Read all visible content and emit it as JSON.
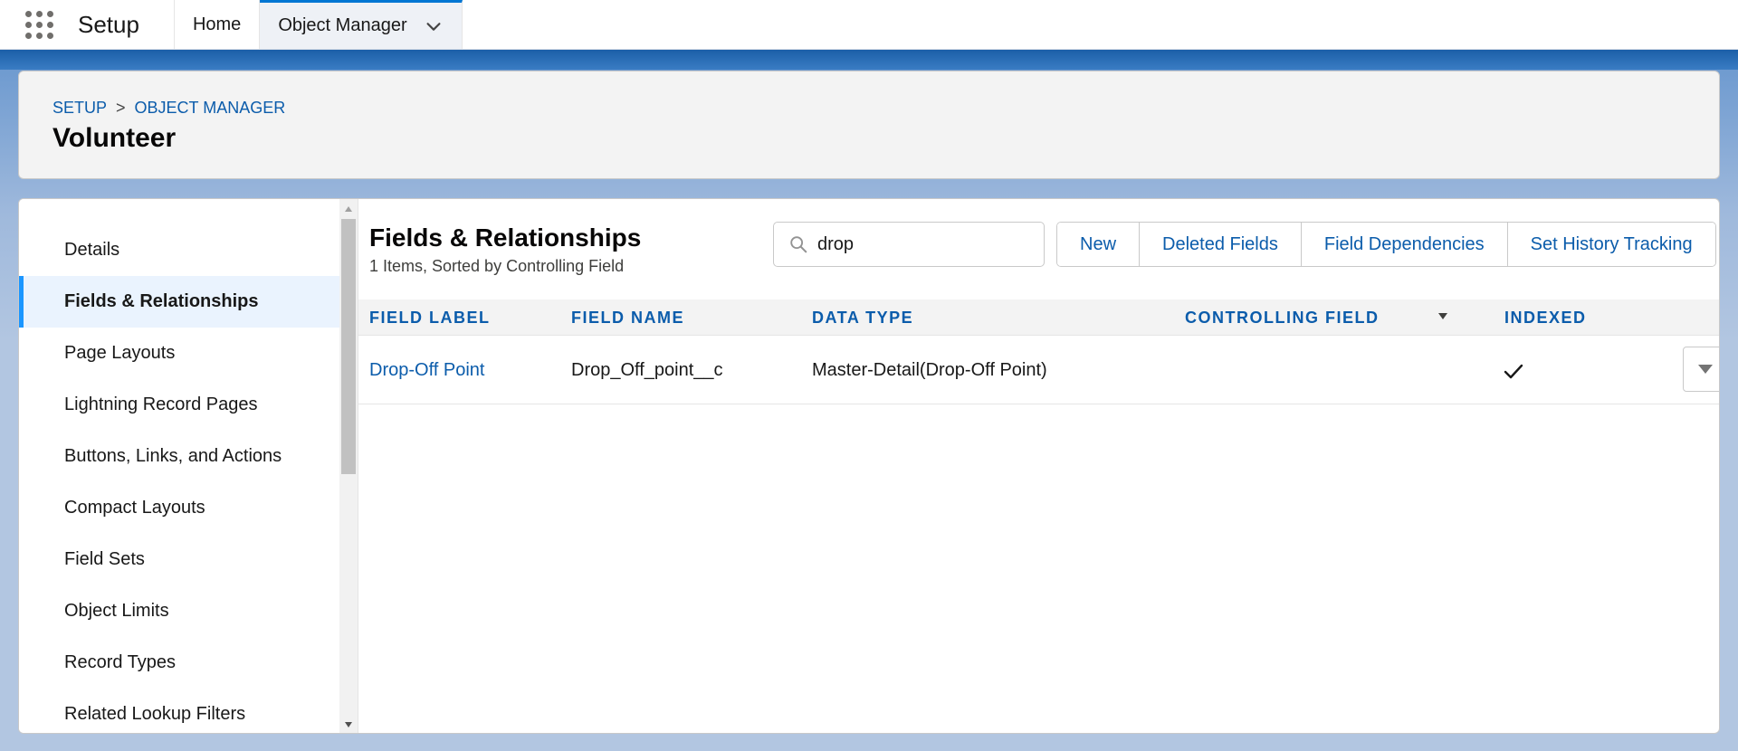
{
  "topbar": {
    "app_name": "Setup",
    "tabs": [
      {
        "label": "Home"
      },
      {
        "label": "Object Manager"
      }
    ]
  },
  "header": {
    "breadcrumb": [
      "SETUP",
      "OBJECT MANAGER"
    ],
    "breadcrumb_separator": ">",
    "title": "Volunteer"
  },
  "sidebar": {
    "items": [
      {
        "label": "Details"
      },
      {
        "label": "Fields & Relationships"
      },
      {
        "label": "Page Layouts"
      },
      {
        "label": "Lightning Record Pages"
      },
      {
        "label": "Buttons, Links, and Actions"
      },
      {
        "label": "Compact Layouts"
      },
      {
        "label": "Field Sets"
      },
      {
        "label": "Object Limits"
      },
      {
        "label": "Record Types"
      },
      {
        "label": "Related Lookup Filters"
      }
    ],
    "active_index": 1
  },
  "main": {
    "title": "Fields & Relationships",
    "subtitle": "1 Items, Sorted by Controlling Field",
    "search": {
      "value": "drop"
    },
    "buttons": {
      "new": "New",
      "deleted_fields": "Deleted Fields",
      "field_dependencies": "Field Dependencies",
      "set_history_tracking": "Set History Tracking"
    },
    "columns": {
      "field_label": "FIELD LABEL",
      "field_name": "FIELD NAME",
      "data_type": "DATA TYPE",
      "controlling_field": "CONTROLLING FIELD",
      "indexed": "INDEXED"
    },
    "rows": [
      {
        "field_label": "Drop-Off Point",
        "field_name": "Drop_Off_point__c",
        "data_type": "Master-Detail(Drop-Off Point)",
        "controlling_field": "",
        "indexed": true
      }
    ]
  },
  "colors": {
    "link": "#0b5cab",
    "active_bar": "#1b96ff",
    "brand_band": "#1b5fa8"
  }
}
